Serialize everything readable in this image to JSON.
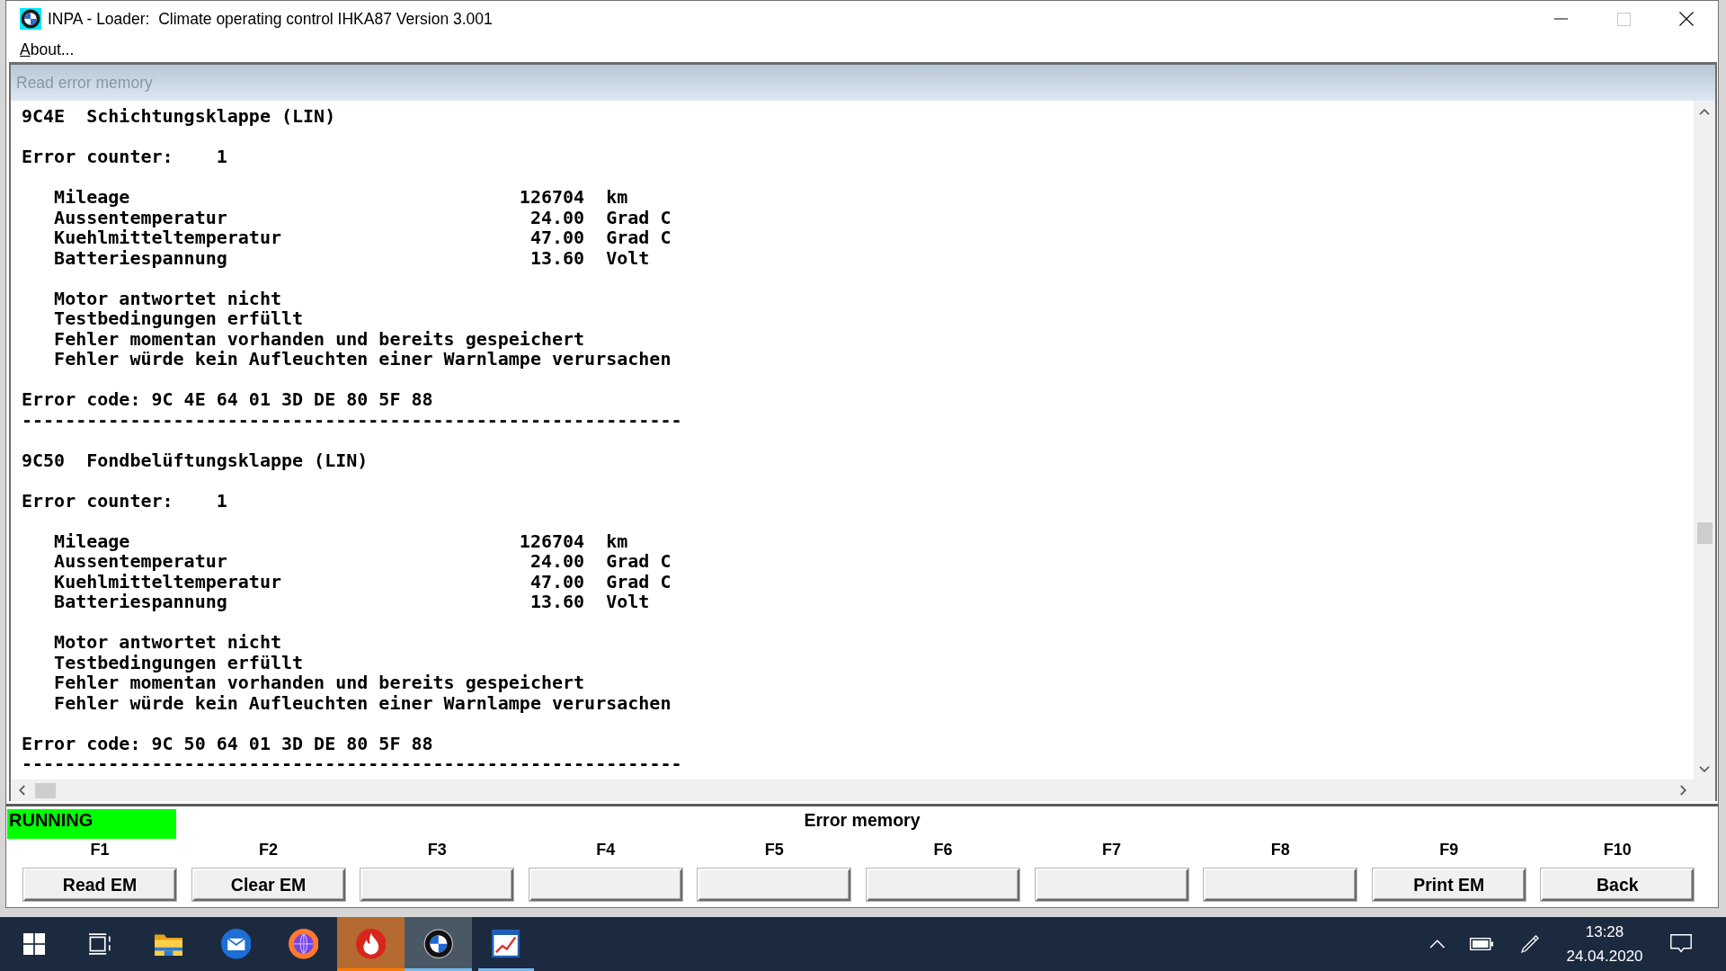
{
  "window": {
    "title": "INPA - Loader:  Climate operating control IHKA87 Version 3.001",
    "maximize_disabled": true
  },
  "menu": [
    {
      "label": "About..."
    }
  ],
  "panel": {
    "title": "Read error memory",
    "entries": [
      {
        "id": "9C4E",
        "name": "Schichtungsklappe (LIN)",
        "counter_label": "Error counter:",
        "counter": "1",
        "conditions": [
          {
            "label": "Mileage",
            "value": "126704",
            "unit": "km"
          },
          {
            "label": "Aussentemperatur",
            "value": "24.00",
            "unit": "Grad C"
          },
          {
            "label": "Kuehlmitteltemperatur",
            "value": "47.00",
            "unit": "Grad C"
          },
          {
            "label": "Batteriespannung",
            "value": "13.60",
            "unit": "Volt"
          }
        ],
        "messages": [
          "Motor antwortet nicht",
          "Testbedingungen erfüllt",
          "Fehler momentan vorhanden und bereits gespeichert",
          "Fehler würde kein Aufleuchten einer Warnlampe verursachen"
        ],
        "code_label": "Error code:",
        "code": "9C 4E 64 01 3D DE 80 5F 88",
        "separator": "-------------------------------------------------------------"
      },
      {
        "id": "9C50",
        "name": "Fondbelüftungsklappe (LIN)",
        "counter_label": "Error counter:",
        "counter": "1",
        "conditions": [
          {
            "label": "Mileage",
            "value": "126704",
            "unit": "km"
          },
          {
            "label": "Aussentemperatur",
            "value": "24.00",
            "unit": "Grad C"
          },
          {
            "label": "Kuehlmitteltemperatur",
            "value": "47.00",
            "unit": "Grad C"
          },
          {
            "label": "Batteriespannung",
            "value": "13.60",
            "unit": "Volt"
          }
        ],
        "messages": [
          "Motor antwortet nicht",
          "Testbedingungen erfüllt",
          "Fehler momentan vorhanden und bereits gespeichert",
          "Fehler würde kein Aufleuchten einer Warnlampe verursachen"
        ],
        "code_label": "Error code:",
        "code": "9C 50 64 01 3D DE 80 5F 88",
        "separator": "-------------------------------------------------------------"
      }
    ]
  },
  "status": {
    "label": "RUNNING",
    "running": true,
    "title": "Error memory"
  },
  "function_keys": [
    {
      "key": "F1",
      "label": "Read EM"
    },
    {
      "key": "F2",
      "label": "Clear EM"
    },
    {
      "key": "F3"
    },
    {
      "key": "F4"
    },
    {
      "key": "F5"
    },
    {
      "key": "F6"
    },
    {
      "key": "F7"
    },
    {
      "key": "F8"
    },
    {
      "key": "F9",
      "label": "Print EM"
    },
    {
      "key": "F10",
      "label": "Back"
    }
  ],
  "taskbar": {
    "apps": [
      {
        "kind": "folder",
        "running": false,
        "active": false,
        "attention": false
      },
      {
        "kind": "mail",
        "running": false,
        "active": false,
        "attention": false
      },
      {
        "kind": "globe",
        "running": false,
        "active": false,
        "attention": false
      },
      {
        "kind": "flame",
        "running": true,
        "active": false,
        "attention": true
      },
      {
        "kind": "roundel",
        "running": true,
        "active": true,
        "attention": false
      },
      {
        "kind": "chart",
        "running": true,
        "active": false,
        "attention": false
      }
    ],
    "time": "13:28",
    "date": "24.04.2020"
  }
}
